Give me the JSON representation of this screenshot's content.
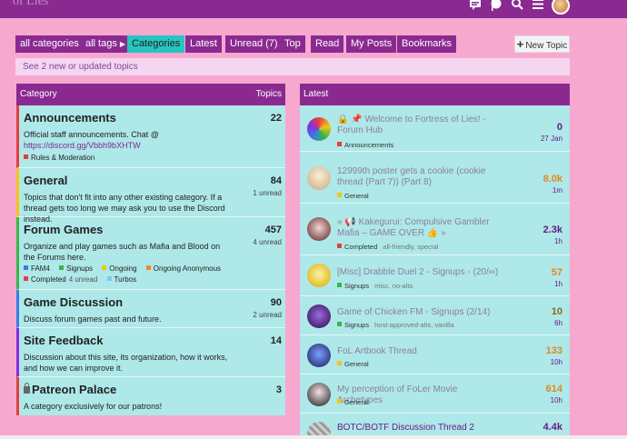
{
  "header": {
    "logo_text": "of Lies",
    "icons": [
      "chat-icon",
      "notification-icon",
      "search-icon",
      "menu-icon",
      "avatar"
    ]
  },
  "nav": {
    "items": [
      {
        "label": "all categories",
        "caret": true
      },
      {
        "label": "all tags",
        "caret": true
      },
      {
        "label": "Categories",
        "active": true
      },
      {
        "label": "Latest"
      },
      {
        "label": "Unread (7)"
      },
      {
        "label": "Top"
      },
      {
        "label": "Read"
      },
      {
        "label": "My Posts"
      },
      {
        "label": "Bookmarks"
      }
    ],
    "new_topic": "New Topic"
  },
  "banner": "See 2 new or updated topics",
  "categories": {
    "header_left": "Category",
    "header_right": "Topics",
    "items": [
      {
        "name": "Announcements",
        "count": "22",
        "unread": "",
        "color": "#e23f3f",
        "desc": "Official staff announcements. Chat @",
        "link": "https://discord.gg/Vbbh9bXHTW",
        "subs": [
          {
            "label": "Rules & Moderation",
            "color": "#e23f3f",
            "unread": ""
          }
        ]
      },
      {
        "name": "General",
        "count": "84",
        "unread": "1 unread",
        "color": "#f5c518",
        "desc": "Topics that don't fit into any other existing category. If a thread gets too long we may ask you to use the Discord instead.",
        "subs": []
      },
      {
        "name": "Forum Games",
        "count": "457",
        "unread": "4 unread",
        "color": "#3ab54a",
        "desc": "Organize and play games such as Mafia and Blood on the Forums here.",
        "subs": [
          {
            "label": "FAM4",
            "color": "#3a7de0",
            "unread": ""
          },
          {
            "label": "Signups",
            "color": "#3ab54a",
            "unread": ""
          },
          {
            "label": "Ongoing",
            "color": "#f5c518",
            "unread": ""
          },
          {
            "label": "Ongoing Anonymous",
            "color": "#f08a24",
            "unread": ""
          },
          {
            "label": "Completed",
            "color": "#e23f3f",
            "unread": "4 unread"
          },
          {
            "label": "Turbos",
            "color": "#6ecff6",
            "unread": ""
          }
        ]
      },
      {
        "name": "Game Discussion",
        "count": "90",
        "unread": "2 unread",
        "color": "#3a7de0",
        "desc": "Discuss forum games past and future.",
        "subs": []
      },
      {
        "name": "Site Feedback",
        "count": "14",
        "unread": "",
        "color": "#8a2be2",
        "desc": "Discussion about this site, its organization, how it works, and how we can improve it.",
        "subs": []
      },
      {
        "name": "Patreon Palace",
        "count": "3",
        "unread": "",
        "color": "#e23f3f",
        "locked": true,
        "desc": "A category exclusively for our patrons!",
        "subs": []
      }
    ]
  },
  "latest": {
    "header": "Latest",
    "topics": [
      {
        "title": "🔒 📌 Welcome to Fortress of Lies! - Forum Hub",
        "category": "Announcements",
        "cat_color": "#e23f3f",
        "tags": "",
        "posts": "0",
        "posts_color": "#6a1a8a",
        "age": "27 Jan",
        "avatar": "rainbow"
      },
      {
        "title": "12999th poster gets a cookie (cookie thread (Part 7)) (Part 8)",
        "category": "General",
        "cat_color": "#f5c518",
        "tags": "",
        "posts": "8.0k",
        "posts_color": "#e08a1a",
        "age": "1m",
        "avatar": "tan"
      },
      {
        "title": "» 📢 Kakegurui: Compulsive Gambler Mafia – GAME OVER 👍 »",
        "category": "Completed",
        "cat_color": "#e23f3f",
        "tags": "all-friendly, special",
        "posts": "2.3k",
        "posts_color": "#6a1a8a",
        "age": "1h",
        "avatar": "dark"
      },
      {
        "title": "[Misc] Drabble Duel 2 - Signups - (20/∞)",
        "category": "Signups",
        "cat_color": "#3ab54a",
        "tags": "misc, no-alts",
        "posts": "57",
        "posts_color": "#e08a1a",
        "age": "1h",
        "avatar": "yellow"
      },
      {
        "title": "Game of Chicken FM - Signups (2/14)",
        "category": "Signups",
        "cat_color": "#3ab54a",
        "tags": "host-approved-alts, vanilla",
        "posts": "10",
        "posts_color": "#8a6a1a",
        "age": "6h",
        "avatar": "purple"
      },
      {
        "title": "FoL Artbook Thread",
        "category": "General",
        "cat_color": "#f5c518",
        "tags": "",
        "posts": "133",
        "posts_color": "#e08a1a",
        "age": "10h",
        "avatar": "blue"
      },
      {
        "title": "My perception of FoLer Movie Archetypes",
        "category": "General",
        "cat_color": "#f5c518",
        "tags": "",
        "posts": "614",
        "posts_color": "#e08a1a",
        "age": "10h",
        "avatar": "anime"
      },
      {
        "title": "BOTC/BOTF Discussion Thread 2",
        "category": "",
        "cat_color": "#3a7de0",
        "tags": "",
        "posts": "4.4k",
        "posts_color": "#6a1a8a",
        "age": "",
        "avatar": "grey",
        "strong": true
      }
    ]
  }
}
